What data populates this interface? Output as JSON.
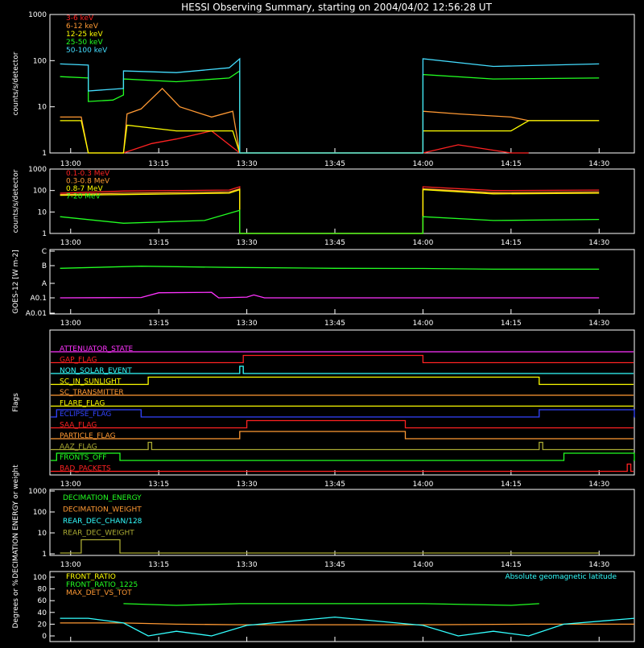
{
  "colors": {
    "c36": "#ff2222",
    "c612": "#ff9933",
    "c1225": "#ffff00",
    "c2550": "#22ff22",
    "c50100": "#44ddff",
    "white": "#ffffff",
    "magenta": "#ff33ff",
    "blue": "#3344ff",
    "olive": "#aaaa33",
    "cyan": "#33ffff"
  },
  "chart_data": [
    {
      "type": "line",
      "title": "HESSI Observing Summary, starting on 2004/04/02 12:56:28 UT",
      "ylabel": "counts/s/detector",
      "yscale": "log",
      "ylim": [
        1,
        1000
      ],
      "yticks": [
        "1",
        "10",
        "100",
        "1000"
      ],
      "xticks": [
        "13:00",
        "13:15",
        "13:30",
        "13:45",
        "14:00",
        "14:15",
        "14:30"
      ],
      "series": [
        {
          "name": "3-6 keV",
          "color": "#ff2222",
          "points": [
            [
              13.15,
              1
            ],
            [
              13.23,
              1.6
            ],
            [
              13.3,
              2
            ],
            [
              13.4,
              3
            ],
            [
              13.48,
              1
            ],
            [
              14.0,
              1
            ],
            [
              14.1,
              1.5
            ],
            [
              14.25,
              1
            ],
            [
              14.3,
              1
            ]
          ]
        },
        {
          "name": "6-12 keV",
          "color": "#ff9933",
          "points": [
            [
              12.97,
              6
            ],
            [
              13.03,
              6
            ],
            [
              13.05,
              1
            ],
            [
              13.15,
              1
            ],
            [
              13.16,
              7
            ],
            [
              13.2,
              9
            ],
            [
              13.26,
              25
            ],
            [
              13.31,
              10
            ],
            [
              13.4,
              6
            ],
            [
              13.46,
              8
            ],
            [
              13.48,
              1
            ],
            [
              14.0,
              1
            ],
            [
              14.0,
              8
            ],
            [
              14.1,
              7
            ],
            [
              14.25,
              6
            ],
            [
              14.3,
              5
            ],
            [
              14.5,
              5
            ]
          ]
        },
        {
          "name": "12-25 keV",
          "color": "#ffff00",
          "points": [
            [
              12.97,
              5
            ],
            [
              13.03,
              5
            ],
            [
              13.05,
              1
            ],
            [
              13.15,
              1
            ],
            [
              13.16,
              4
            ],
            [
              13.3,
              3
            ],
            [
              13.46,
              3
            ],
            [
              13.48,
              1
            ],
            [
              14.0,
              1
            ],
            [
              14.0,
              3
            ],
            [
              14.25,
              3
            ],
            [
              14.3,
              5
            ],
            [
              14.5,
              5
            ]
          ]
        },
        {
          "name": "25-50 keV",
          "color": "#22ff22",
          "points": [
            [
              12.97,
              45
            ],
            [
              13.05,
              42
            ],
            [
              13.05,
              13
            ],
            [
              13.12,
              14
            ],
            [
              13.15,
              18
            ],
            [
              13.15,
              40
            ],
            [
              13.3,
              35
            ],
            [
              13.45,
              42
            ],
            [
              13.48,
              60
            ],
            [
              13.48,
              1
            ],
            [
              14.0,
              1
            ],
            [
              14.0,
              50
            ],
            [
              14.2,
              40
            ],
            [
              14.5,
              42
            ]
          ]
        },
        {
          "name": "50-100 keV",
          "color": "#44ddff",
          "points": [
            [
              12.97,
              85
            ],
            [
              13.05,
              80
            ],
            [
              13.05,
              22
            ],
            [
              13.15,
              25
            ],
            [
              13.15,
              60
            ],
            [
              13.3,
              55
            ],
            [
              13.45,
              70
            ],
            [
              13.48,
              110
            ],
            [
              13.48,
              1
            ],
            [
              14.0,
              1
            ],
            [
              14.0,
              110
            ],
            [
              14.2,
              75
            ],
            [
              14.5,
              85
            ]
          ]
        }
      ]
    },
    {
      "type": "line",
      "ylabel": "counts/s/detector",
      "yscale": "log",
      "ylim": [
        1,
        1000
      ],
      "yticks": [
        "1",
        "10",
        "100",
        "1000"
      ],
      "xticks": [
        "13:00",
        "13:15",
        "13:30",
        "13:45",
        "14:00",
        "14:15",
        "14:30"
      ],
      "series": [
        {
          "name": "0.1-0.3 MeV",
          "color": "#ff2222",
          "points": [
            [
              12.97,
              75
            ],
            [
              13.15,
              95
            ],
            [
              13.45,
              105
            ],
            [
              13.48,
              150
            ],
            [
              13.48,
              1
            ],
            [
              14.0,
              1
            ],
            [
              14.0,
              150
            ],
            [
              14.2,
              100
            ],
            [
              14.5,
              105
            ]
          ]
        },
        {
          "name": "0.3-0.8 MeV",
          "color": "#ff9933",
          "points": [
            [
              12.97,
              65
            ],
            [
              13.15,
              75
            ],
            [
              13.45,
              85
            ],
            [
              13.48,
              120
            ],
            [
              13.48,
              1
            ],
            [
              14.0,
              1
            ],
            [
              14.0,
              120
            ],
            [
              14.2,
              80
            ],
            [
              14.5,
              85
            ]
          ]
        },
        {
          "name": "0.8-7 MeV",
          "color": "#ffff00",
          "points": [
            [
              12.97,
              60
            ],
            [
              13.15,
              65
            ],
            [
              13.45,
              75
            ],
            [
              13.48,
              110
            ],
            [
              13.48,
              1
            ],
            [
              14.0,
              1
            ],
            [
              14.0,
              110
            ],
            [
              14.2,
              70
            ],
            [
              14.5,
              75
            ]
          ]
        },
        {
          "name": "7-20 MeV",
          "color": "#22ff22",
          "points": [
            [
              12.97,
              6
            ],
            [
              13.15,
              3
            ],
            [
              13.38,
              4
            ],
            [
              13.48,
              12
            ],
            [
              13.48,
              1
            ],
            [
              14.0,
              1
            ],
            [
              14.0,
              6
            ],
            [
              14.2,
              4
            ],
            [
              14.5,
              4.5
            ]
          ]
        }
      ]
    },
    {
      "type": "line",
      "ylabel": "GOES-12 [W m-2]",
      "yticks": [
        "A0.01",
        "A0.1",
        "A",
        "B",
        "C"
      ],
      "xticks": [
        "13:00",
        "13:15",
        "13:30",
        "13:45",
        "14:00",
        "14:15",
        "14:30"
      ],
      "series": [
        {
          "color": "#22ff22",
          "points": [
            [
              12.97,
              2.85
            ],
            [
              13.2,
              2.97
            ],
            [
              13.45,
              2.9
            ],
            [
              13.75,
              2.85
            ],
            [
              14.0,
              2.84
            ],
            [
              14.2,
              2.8
            ],
            [
              14.5,
              2.8
            ]
          ]
        },
        {
          "color": "#ff33ff",
          "points": [
            [
              12.97,
              1.0
            ],
            [
              13.2,
              1.02
            ],
            [
              13.25,
              1.35
            ],
            [
              13.4,
              1.38
            ],
            [
              13.42,
              1.0
            ],
            [
              13.5,
              1.05
            ],
            [
              13.52,
              1.2
            ],
            [
              13.55,
              1.0
            ],
            [
              14.5,
              1.0
            ]
          ]
        }
      ]
    },
    {
      "type": "line",
      "ylabel": "Flags",
      "xticks": [
        "13:00",
        "13:15",
        "13:30",
        "13:45",
        "14:00",
        "14:15",
        "14:30"
      ],
      "flags": [
        {
          "label": "ATTENUATOR_STATE",
          "color": "#ff33ff",
          "on": []
        },
        {
          "label": "GAP_FLAG",
          "color": "#ff2222",
          "on": [
            [
              13.49,
              14.0
            ]
          ]
        },
        {
          "label": "NON_SOLAR_EVENT",
          "color": "#33ffff",
          "on": [
            [
              13.48,
              13.49
            ]
          ]
        },
        {
          "label": "SC_IN_SUNLIGHT",
          "color": "#ffff00",
          "on": [
            [
              13.22,
              14.33
            ]
          ]
        },
        {
          "label": "SC_TRANSMITTER",
          "color": "#ff9933",
          "on": []
        },
        {
          "label": "FLARE_FLAG",
          "color": "#ffff00",
          "on": []
        },
        {
          "label": "ECLIPSE_FLAG",
          "color": "#3344ff",
          "on": [
            [
              12.96,
              13.2
            ],
            [
              14.33,
              14.6
            ]
          ]
        },
        {
          "label": "SAA_FLAG",
          "color": "#ff2222",
          "on": [
            [
              13.5,
              13.95
            ]
          ]
        },
        {
          "label": "PARTICLE_FLAG",
          "color": "#ff9933",
          "on": [
            [
              13.48,
              13.95
            ]
          ]
        },
        {
          "label": "AAZ_FLAG",
          "color": "#aaaa33",
          "on": [
            [
              13.22,
              13.23
            ],
            [
              14.33,
              14.34
            ]
          ]
        },
        {
          "label": "FRONTS_OFF",
          "color": "#22ff22",
          "on": [
            [
              12.96,
              13.14
            ],
            [
              14.4,
              14.6
            ]
          ]
        },
        {
          "label": "BAD_PACKETS",
          "color": "#ff2222",
          "on": [
            [
              14.58,
              14.59
            ]
          ]
        }
      ]
    },
    {
      "type": "line",
      "ylabel": "DECIMATION ENERGY or weight",
      "yscale": "log",
      "ylim": [
        1,
        1000
      ],
      "yticks": [
        "1",
        "10",
        "100",
        "1000"
      ],
      "xticks": [
        "13:00",
        "13:15",
        "13:30",
        "13:45",
        "14:00",
        "14:15",
        "14:30"
      ],
      "series": [
        {
          "name": "DECIMATION_ENERGY",
          "color": "#22ff22",
          "points": []
        },
        {
          "name": "DECIMATION_WEIGHT",
          "color": "#ff9933",
          "points": []
        },
        {
          "name": "REAR_DEC_CHAN/128",
          "color": "#33ffff",
          "points": []
        },
        {
          "name": "REAR_DEC_WEIGHT",
          "color": "#aaaa33",
          "points": [
            [
              12.97,
              1
            ],
            [
              13.03,
              1
            ],
            [
              13.03,
              4
            ],
            [
              13.14,
              4
            ],
            [
              13.14,
              1
            ],
            [
              14.5,
              1
            ]
          ]
        }
      ]
    },
    {
      "type": "line",
      "ylabel": "Degrees or %",
      "ylim": [
        0,
        100
      ],
      "yticks": [
        "0",
        "20",
        "40",
        "60",
        "80",
        "100"
      ],
      "xticks": [
        "13:00",
        "13:15",
        "13:30",
        "13:45",
        "14:00",
        "14:15",
        "14:30"
      ],
      "annotation": "Absolute geomagnetic latitude",
      "series": [
        {
          "name": "FRONT_RATIO",
          "color": "#ffff00",
          "points": []
        },
        {
          "name": "FRONT_RATIO_1225",
          "color": "#22ff22",
          "points": [
            [
              13.15,
              55
            ],
            [
              13.3,
              52
            ],
            [
              13.48,
              55
            ],
            [
              14.0,
              55
            ],
            [
              14.25,
              52
            ],
            [
              14.33,
              55
            ]
          ]
        },
        {
          "name": "MAX_DET_VS_TOT",
          "color": "#ff9933",
          "points": [
            [
              12.97,
              22
            ],
            [
              13.15,
              22
            ],
            [
              13.3,
              20
            ],
            [
              13.48,
              19
            ],
            [
              14.0,
              19
            ],
            [
              14.3,
              20
            ],
            [
              14.6,
              20
            ]
          ]
        },
        {
          "name": "Absolute geomagnetic latitude",
          "color": "#33ffff",
          "points": [
            [
              12.97,
              30
            ],
            [
              13.05,
              30
            ],
            [
              13.15,
              22
            ],
            [
              13.22,
              0
            ],
            [
              13.3,
              8
            ],
            [
              13.4,
              0
            ],
            [
              13.5,
              18
            ],
            [
              13.75,
              32
            ],
            [
              14.0,
              18
            ],
            [
              14.1,
              0
            ],
            [
              14.2,
              8
            ],
            [
              14.3,
              0
            ],
            [
              14.4,
              20
            ],
            [
              14.6,
              30
            ]
          ]
        }
      ]
    }
  ]
}
